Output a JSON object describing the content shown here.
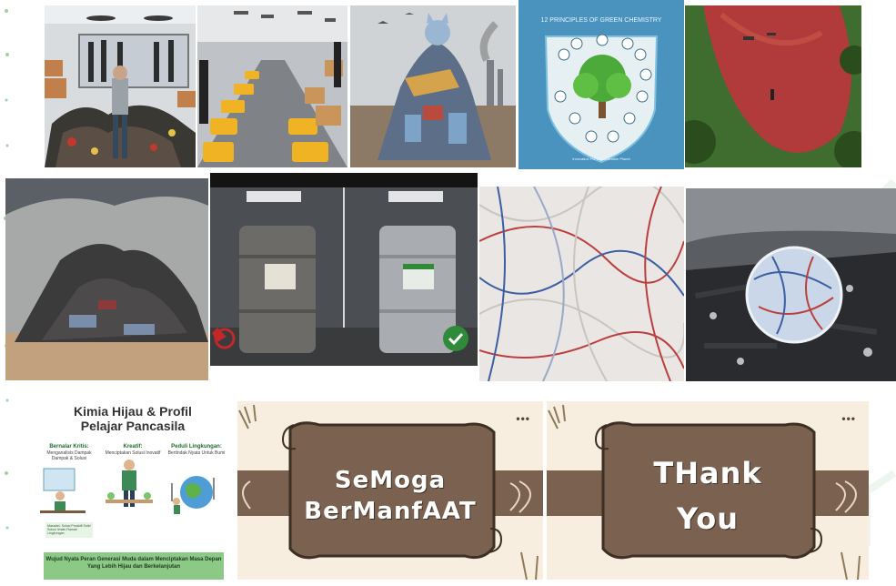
{
  "collage": {
    "tiles": [
      {
        "id": "fashion-pile"
      },
      {
        "id": "factory-line"
      },
      {
        "id": "cat-on-pile"
      },
      {
        "id": "green-chem-poster",
        "text": "12 PRINCIPLES OF GREEN CHEMISTRY",
        "subtext": "Innovation For a Sustainable Planet"
      },
      {
        "id": "red-river"
      },
      {
        "id": "desert-clothes-pile"
      },
      {
        "id": "chemical-barrels"
      },
      {
        "id": "microfibers"
      },
      {
        "id": "polluted-shore"
      }
    ],
    "profile_slide": {
      "title_line1": "Kimia Hijau & Profil",
      "title_line2": "Pelajar Pancasila",
      "columns": [
        {
          "heading": "Bernalar Kritis:",
          "sub": "Menganalisis Dampak Dampak & Solusi"
        },
        {
          "heading": "Kreatif:",
          "sub": "Menciptakan Solusi Inovatif"
        },
        {
          "heading": "Peduli Lingkungan:",
          "sub": "Bertindak Nyata Untuk Bumi"
        }
      ],
      "note": "Masalah: Solusi Proaktif Solid Solusi Ilmiah Ramah Lingkungan",
      "footer": "Wujud Nyata Peran Generasi Muda dalam Menciptakan Masa Depan Yang Lebih Hijau dan Berkelanjutan"
    },
    "scroll_slides": [
      {
        "line1": "SeMoga",
        "line2": "BerManfAAT",
        "dots": "•••"
      },
      {
        "line1": "THank",
        "line2": "You",
        "dots": "•••"
      }
    ],
    "colors": {
      "brown": "#7a6150",
      "dark_brown": "#3d2f24",
      "cream": "#f7eedf",
      "green": "#8cc987"
    }
  }
}
